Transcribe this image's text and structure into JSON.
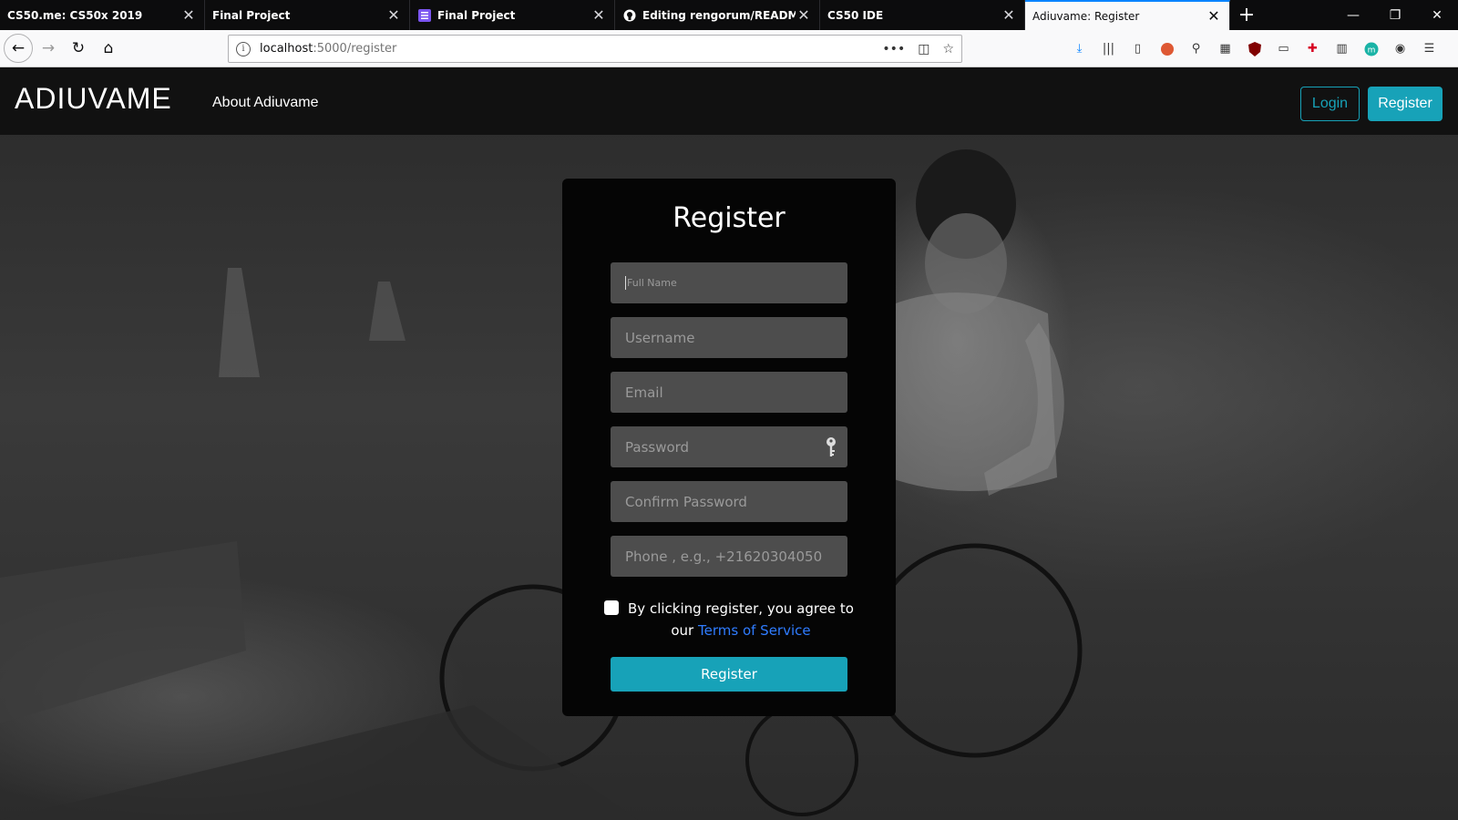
{
  "browser": {
    "tabs": [
      {
        "title": "CS50.me: CS50x 2019",
        "icon": "none",
        "active": false
      },
      {
        "title": "Final Project",
        "icon": "none",
        "active": false
      },
      {
        "title": "Final Project",
        "icon": "list-icon",
        "active": false
      },
      {
        "title": "Editing rengorum/README.md",
        "icon": "github-icon",
        "active": false
      },
      {
        "title": "CS50 IDE",
        "icon": "none",
        "active": false
      },
      {
        "title": "Adiuvame: Register",
        "icon": "none",
        "active": true
      }
    ],
    "url_host": "localhost",
    "url_path": ":5000/register"
  },
  "site": {
    "brand": "ADIUVAME",
    "nav_about": "About Adiuvame",
    "login_label": "Login",
    "register_label": "Register"
  },
  "form": {
    "title": "Register",
    "fields": {
      "full_name": "Full Name",
      "username": "Username",
      "email": "Email",
      "password": "Password",
      "confirm_password": "Confirm Password",
      "phone": "Phone , e.g., +21620304050"
    },
    "terms_prefix": "By clicking register, you agree to our",
    "terms_link": "Terms of Service",
    "submit_label": "Register"
  },
  "colors": {
    "accent": "#17a2b8",
    "link": "#2f7cff",
    "card_bg": "#050505",
    "field_bg": "#4d4d4d"
  }
}
